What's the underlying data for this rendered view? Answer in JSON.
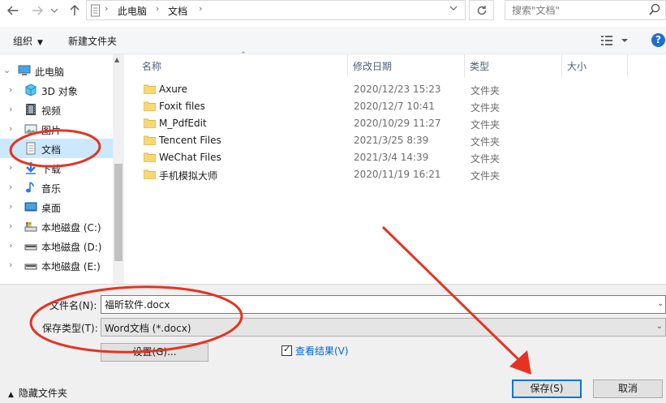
{
  "address_bar": {
    "back_icon": "arrow-left-icon",
    "forward_icon": "arrow-right-icon",
    "recent_icon": "chevron-down-icon",
    "up_icon": "arrow-up-icon",
    "crumbs": [
      "此电脑",
      "文档"
    ],
    "refresh_icon": "refresh-icon",
    "search_placeholder": "搜索\"文档\""
  },
  "toolbar": {
    "organize_label": "组织",
    "new_folder_label": "新建文件夹",
    "view_icon": "view-options-icon",
    "help_label": "?"
  },
  "nav": {
    "items": [
      {
        "label": "此电脑",
        "icon": "computer-icon",
        "selected": false
      },
      {
        "label": "3D 对象",
        "icon": "cube-3d-icon",
        "selected": false
      },
      {
        "label": "视频",
        "icon": "video-icon",
        "selected": false
      },
      {
        "label": "图片",
        "icon": "pictures-icon",
        "selected": false
      },
      {
        "label": "文档",
        "icon": "document-icon",
        "selected": true
      },
      {
        "label": "下载",
        "icon": "download-icon",
        "selected": false
      },
      {
        "label": "音乐",
        "icon": "music-icon",
        "selected": false
      },
      {
        "label": "桌面",
        "icon": "desktop-icon",
        "selected": false
      },
      {
        "label": "本地磁盘 (C:)",
        "icon": "drive-c-icon",
        "selected": false
      },
      {
        "label": "本地磁盘 (D:)",
        "icon": "drive-icon",
        "selected": false
      },
      {
        "label": "本地磁盘 (E:)",
        "icon": "drive-icon",
        "selected": false
      }
    ]
  },
  "files": {
    "columns": [
      "名称",
      "修改日期",
      "类型",
      "大小"
    ],
    "rows": [
      {
        "name": "Axure",
        "date": "2020/12/23 15:23",
        "type": "文件夹"
      },
      {
        "name": "Foxit files",
        "date": "2020/12/7 10:41",
        "type": "文件夹"
      },
      {
        "name": "M_PdfEdit",
        "date": "2020/10/29 11:27",
        "type": "文件夹"
      },
      {
        "name": "Tencent Files",
        "date": "2021/3/25 8:39",
        "type": "文件夹"
      },
      {
        "name": "WeChat Files",
        "date": "2021/3/4 14:39",
        "type": "文件夹"
      },
      {
        "name": "手机模拟大师",
        "date": "2020/11/19 16:21",
        "type": "文件夹"
      }
    ]
  },
  "save_panel": {
    "filename_label": "文件名(N):",
    "filename_value": "福昕软件.docx",
    "filetype_label": "保存类型(T):",
    "filetype_value": "Word文档 (*.docx)",
    "settings_button": "设置(G)...",
    "view_results_label": "查看结果(V)",
    "view_results_checked": true,
    "hide_folders_label": "隐藏文件夹",
    "save_button": "保存(S)",
    "cancel_button": "取消"
  },
  "annotation_color": "#e53322",
  "selection_color": "#cce8ff",
  "folder_color": "#f8d775"
}
